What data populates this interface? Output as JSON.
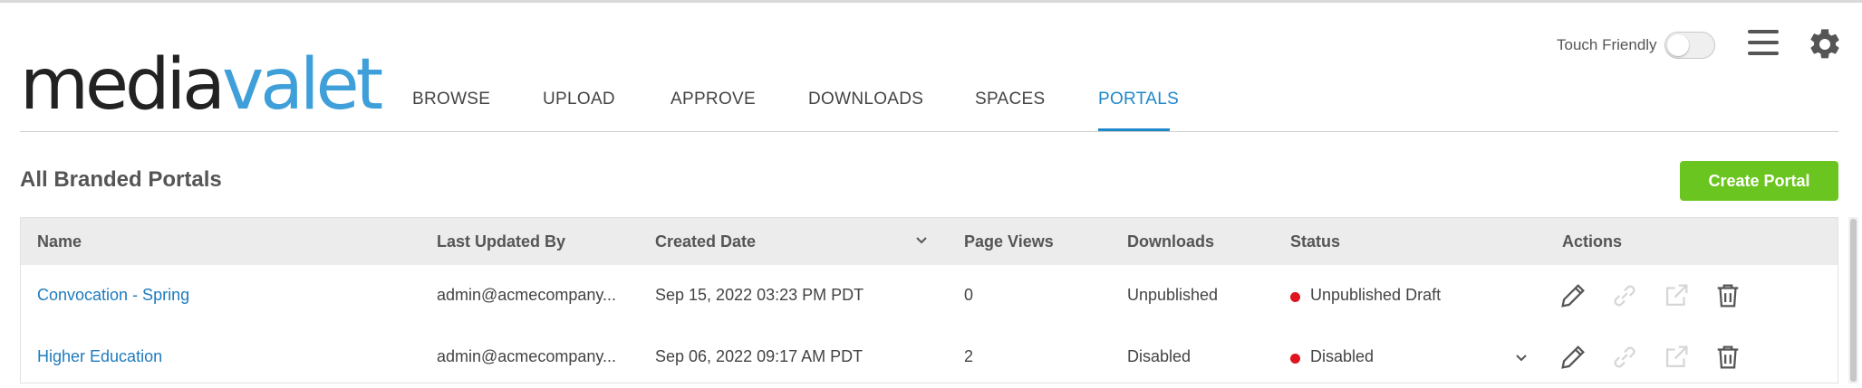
{
  "brand": {
    "logo_part1": "media",
    "logo_part2": "valet"
  },
  "nav": {
    "items": [
      {
        "label": "BROWSE",
        "active": false
      },
      {
        "label": "UPLOAD",
        "active": false
      },
      {
        "label": "APPROVE",
        "active": false
      },
      {
        "label": "DOWNLOADS",
        "active": false
      },
      {
        "label": "SPACES",
        "active": false
      },
      {
        "label": "PORTALS",
        "active": true
      }
    ]
  },
  "header": {
    "touch_friendly_label": "Touch Friendly",
    "touch_friendly_on": false
  },
  "page": {
    "title": "All Branded Portals",
    "create_button": "Create Portal"
  },
  "table": {
    "columns": [
      "Name",
      "Last Updated By",
      "Created Date",
      "Page Views",
      "Downloads",
      "Status",
      "Actions"
    ],
    "rows": [
      {
        "name": "Convocation - Spring",
        "last_updated_by": "admin@acmecompany...",
        "created_date": "Sep 15, 2022 03:23 PM PDT",
        "page_views": "0",
        "downloads": "Unpublished",
        "status": "Unpublished Draft"
      },
      {
        "name": "Higher Education",
        "last_updated_by": "admin@acmecompany...",
        "created_date": "Sep 06, 2022 09:17 AM PDT",
        "page_views": "2",
        "downloads": "Disabled",
        "status": "Disabled"
      }
    ]
  },
  "colors": {
    "accent_blue": "#1e87c9",
    "logo_blue": "#3f9fd9",
    "create_green": "#6bc520",
    "status_red": "#e0141e"
  },
  "icons": [
    "menu-icon",
    "gear-icon",
    "sort-chevron-icon",
    "edit-icon",
    "link-icon",
    "open-external-icon",
    "trash-icon",
    "chevron-down-icon"
  ]
}
